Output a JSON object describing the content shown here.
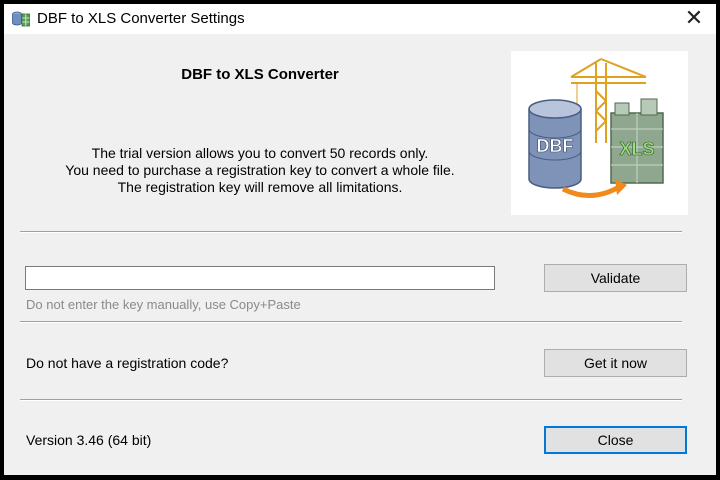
{
  "window": {
    "title": "DBF to XLS Converter Settings",
    "close_icon": "close-icon",
    "app_icon": "database-table-icon"
  },
  "header": {
    "app_name": "DBF to XLS Converter",
    "info_lines": [
      "The trial version allows you to convert 50 records only.",
      "You need to purchase a registration key to convert a whole file.",
      "The registration key will remove all limitations."
    ]
  },
  "logo": {
    "left_label": "DBF",
    "right_label": "XLS"
  },
  "registration": {
    "key_value": "",
    "hint": "Do not enter the key manually, use Copy+Paste",
    "validate_label": "Validate"
  },
  "purchase": {
    "question": "Do not have a registration code?",
    "get_label": "Get it now"
  },
  "footer": {
    "version": "Version 3.46 (64 bit)",
    "close_label": "Close"
  },
  "colors": {
    "dialog_bg": "#f0f0f0",
    "default_button_border": "#0078d7",
    "hint_text": "#8a8a8a"
  }
}
